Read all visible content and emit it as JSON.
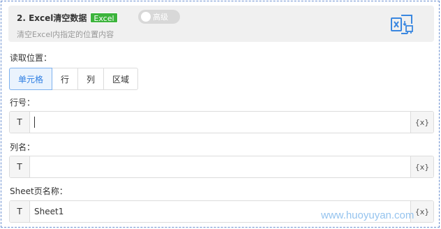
{
  "header": {
    "title": "2. Excel清空数据",
    "tag": "Excel",
    "advanced_toggle": "高级",
    "subtitle": "清空Excel内指定的位置内容",
    "icon": "excel-clear-icon"
  },
  "read_position": {
    "label": "读取位置：",
    "options": [
      "单元格",
      "行",
      "列",
      "区域"
    ],
    "selected": "单元格"
  },
  "row_field": {
    "label": "行号：",
    "prefix": "T",
    "value": "",
    "var_button": "{x}"
  },
  "col_field": {
    "label": "列名：",
    "prefix": "T",
    "value": "",
    "var_button": "{x}"
  },
  "sheet_field": {
    "label": "Sheet页名称：",
    "prefix": "T",
    "value": "Sheet1",
    "var_button": "{x}"
  },
  "watermark": "www.huoyuyan.com",
  "colors": {
    "accent": "#2f7fe3",
    "tag": "#3cb43c",
    "border_dashed": "#6a8fd0"
  }
}
